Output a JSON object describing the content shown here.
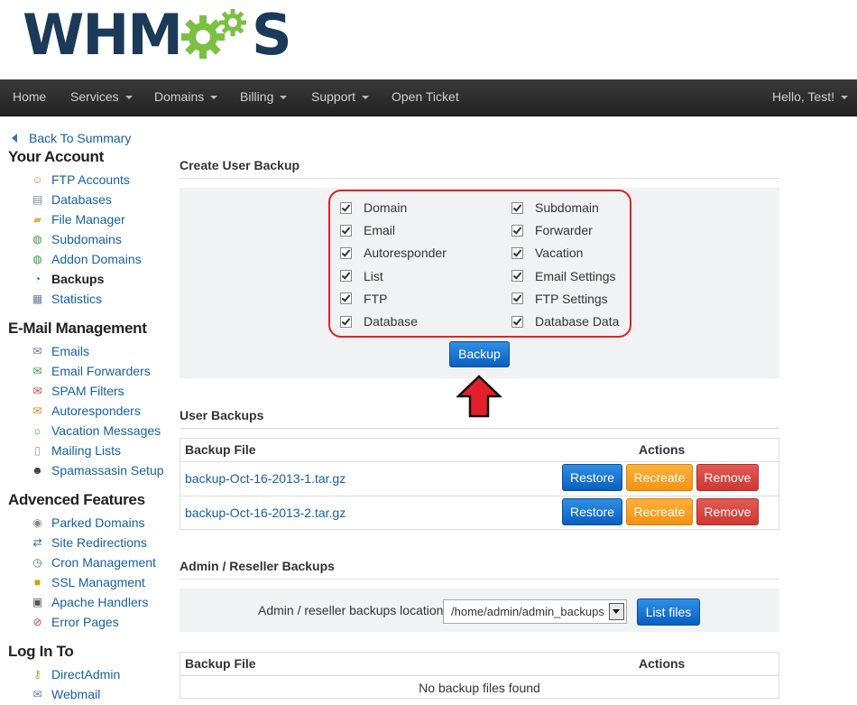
{
  "brand": {
    "logo_left": "WHM",
    "logo_right": "S",
    "colors": {
      "navy": "#1b3a57",
      "green": "#7ac142"
    }
  },
  "navbar": {
    "items": [
      {
        "label": "Home",
        "dropdown": false
      },
      {
        "label": "Services",
        "dropdown": true
      },
      {
        "label": "Domains",
        "dropdown": true
      },
      {
        "label": "Billing",
        "dropdown": true
      },
      {
        "label": "Support",
        "dropdown": true
      },
      {
        "label": "Open Ticket",
        "dropdown": false
      }
    ],
    "user": "Hello, Test!"
  },
  "sidebar": {
    "back_label": "Back To Summary",
    "sections": [
      {
        "title": "Your Account",
        "items": [
          {
            "label": "FTP Accounts",
            "icon": "ftp-user-icon"
          },
          {
            "label": "Databases",
            "icon": "database-icon"
          },
          {
            "label": "File Manager",
            "icon": "folder-icon"
          },
          {
            "label": "Subdomains",
            "icon": "globe-icon"
          },
          {
            "label": "Addon Domains",
            "icon": "globe-add-icon"
          },
          {
            "label": "Backups",
            "icon": "clock-icon",
            "active": true
          },
          {
            "label": "Statistics",
            "icon": "statistics-icon"
          }
        ]
      },
      {
        "title": "E-Mail Management",
        "items": [
          {
            "label": "Emails",
            "icon": "envelope-icon"
          },
          {
            "label": "Email Forwarders",
            "icon": "envelope-forward-icon"
          },
          {
            "label": "SPAM Filters",
            "icon": "envelope-block-icon"
          },
          {
            "label": "Autoresponders",
            "icon": "autoresponder-icon"
          },
          {
            "label": "Vacation Messages",
            "icon": "palm-tree-icon"
          },
          {
            "label": "Mailing Lists",
            "icon": "book-icon"
          },
          {
            "label": "Spamassasin Setup",
            "icon": "spy-icon"
          }
        ]
      },
      {
        "title": "Advenced Features",
        "items": [
          {
            "label": "Parked Domains",
            "icon": "parked-icon"
          },
          {
            "label": "Site Redirections",
            "icon": "redirect-arrows-icon"
          },
          {
            "label": "Cron Management",
            "icon": "cron-icon"
          },
          {
            "label": "SSL Managment",
            "icon": "lock-icon"
          },
          {
            "label": "Apache Handlers",
            "icon": "server-icon"
          },
          {
            "label": "Error Pages",
            "icon": "error-page-icon"
          }
        ]
      },
      {
        "title": "Log In To",
        "items": [
          {
            "label": "DirectAdmin",
            "icon": "key-icon"
          },
          {
            "label": "Webmail",
            "icon": "webmail-icon"
          }
        ]
      }
    ]
  },
  "create_backup": {
    "title": "Create User Backup",
    "options_left": [
      "Domain",
      "Email",
      "Autoresponder",
      "List",
      "FTP",
      "Database"
    ],
    "options_right": [
      "Subdomain",
      "Forwarder",
      "Vacation",
      "Email Settings",
      "FTP Settings",
      "Database Data"
    ],
    "button": "Backup"
  },
  "user_backups": {
    "title": "User Backups",
    "col_file": "Backup File",
    "col_actions": "Actions",
    "rows": [
      {
        "file": "backup-Oct-16-2013-1.tar.gz"
      },
      {
        "file": "backup-Oct-16-2013-2.tar.gz"
      }
    ],
    "restore": "Restore",
    "recreate": "Recreate",
    "remove": "Remove"
  },
  "admin_backups": {
    "title": "Admin / Reseller Backups",
    "location_label": "Admin / reseller backups location:",
    "location_value": "/home/admin/admin_backups",
    "list_button": "List files",
    "col_file": "Backup File",
    "col_actions": "Actions",
    "empty": "No backup files found"
  }
}
